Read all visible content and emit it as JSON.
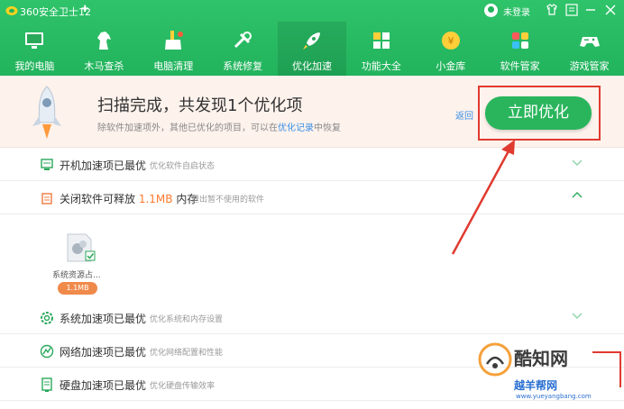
{
  "app": {
    "title": "360安全卫士12",
    "login": "未登录"
  },
  "colors": {
    "brand": "#22b35d",
    "accent": "#ff7a2f",
    "link": "#3a8ee6",
    "annotation": "#e03a30"
  },
  "nav": [
    {
      "label": "我的电脑",
      "icon": "monitor-icon"
    },
    {
      "label": "木马查杀",
      "icon": "horse-icon"
    },
    {
      "label": "电脑清理",
      "icon": "broom-icon"
    },
    {
      "label": "系统修复",
      "icon": "wrench-icon"
    },
    {
      "label": "优化加速",
      "icon": "rocket-icon",
      "active": true
    },
    {
      "label": "功能大全",
      "icon": "grid-icon"
    },
    {
      "label": "小金库",
      "icon": "coin-icon"
    },
    {
      "label": "软件管家",
      "icon": "apps-icon"
    },
    {
      "label": "游戏管家",
      "icon": "gamepad-icon"
    }
  ],
  "banner": {
    "title": "扫描完成，共发现1个优化项",
    "sub_pre": "除软件加速项外，其他已优化的项目，可以在",
    "sub_link": "优化记录",
    "sub_post": "中恢复",
    "back": "返回",
    "button": "立即优化"
  },
  "rows": [
    {
      "title": "开机加速项已最优",
      "desc": "优化软件自启状态",
      "expanded": false
    },
    {
      "title_pre": "关闭软件可释放 ",
      "title_num": "1.1MB",
      "title_post": " 内存",
      "desc": "退出暂不使用的软件",
      "expanded": true
    },
    {
      "title": "系统加速项已最优",
      "desc": "优化系统和内存设置",
      "expanded": false
    },
    {
      "title": "网络加速项已最优",
      "desc": "优化网络配置和性能",
      "expanded": false
    },
    {
      "title": "硬盘加速项已最优",
      "desc": "优化硬盘传输效率",
      "expanded": false
    }
  ],
  "item": {
    "name": "系统资源占...",
    "size": "1.1MB"
  },
  "watermark": {
    "brand": "酷知网",
    "brand2": "越羊帮网",
    "url": "www.yueyangbang.com"
  }
}
